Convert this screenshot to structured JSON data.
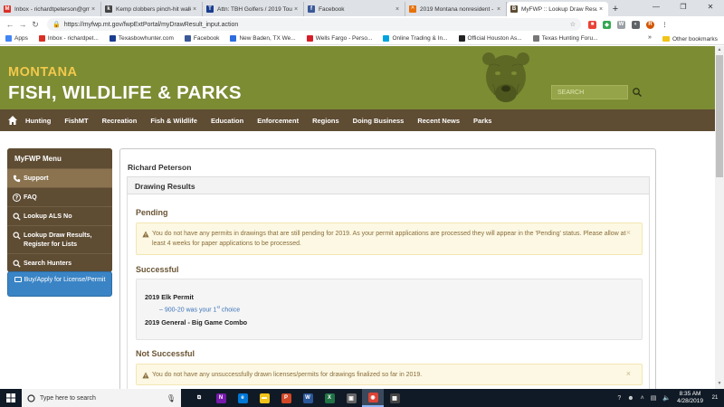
{
  "browser": {
    "tabs": [
      {
        "title": "Inbox - richardtpeterson@gm",
        "favicon": "gmail-icon",
        "color": "#d93025",
        "glyph": "M"
      },
      {
        "title": "Kemp clobbers pinch-hit walk",
        "favicon": "news-icon",
        "color": "#444444",
        "glyph": "k"
      },
      {
        "title": "Attn: TBH Golfers / 2019 Tou",
        "favicon": "forum-icon",
        "color": "#1a3d8f",
        "glyph": "T"
      },
      {
        "title": "Facebook",
        "favicon": "facebook-icon",
        "color": "#3b5998",
        "glyph": "f"
      },
      {
        "title": "2019 Montana nonresident -",
        "favicon": "hunt-icon",
        "color": "#e8710a",
        "glyph": "^"
      },
      {
        "title": "MyFWP :: Lookup Draw Resu",
        "favicon": "fwp-icon",
        "color": "#5e4c33",
        "glyph": "B",
        "active": true
      }
    ],
    "url": "https://myfwp.mt.gov/fwpExtPortal/myDrawResult_input.action",
    "bookmarks": [
      {
        "label": "Apps",
        "color": "#4285f4"
      },
      {
        "label": "Inbox - richardpet...",
        "color": "#d93025"
      },
      {
        "label": "Texasbowhunter.com",
        "color": "#1a3d8f"
      },
      {
        "label": "Facebook",
        "color": "#3b5998"
      },
      {
        "label": "New Baden, TX We...",
        "color": "#2d6cdf"
      },
      {
        "label": "Wells Fargo - Perso...",
        "color": "#d71e28"
      },
      {
        "label": "Online Trading & In...",
        "color": "#00a3e0"
      },
      {
        "label": "Official Houston As...",
        "color": "#222222"
      },
      {
        "label": "Texas Hunting Foru...",
        "color": "#777777"
      }
    ],
    "bookmarks_more": "»",
    "other_bookmarks": "Other bookmarks"
  },
  "site": {
    "brand_line1": "MONTANA",
    "brand_line2": "FISH, WILDLIFE & PARKS",
    "search_placeholder": "SEARCH",
    "nav": [
      "Hunting",
      "FishMT",
      "Recreation",
      "Fish & Wildlife",
      "Education",
      "Enforcement",
      "Regions",
      "Doing Business",
      "Recent News",
      "Parks"
    ],
    "colors": {
      "header": "#7c8c33",
      "nav": "#5e4c33",
      "brand_accent": "#f2c94c",
      "section_title": "#6a5534"
    }
  },
  "sidebar": {
    "title": "MyFWP Menu",
    "items": [
      {
        "label": "Support",
        "icon": "phone-icon"
      },
      {
        "label": "FAQ",
        "icon": "question-icon"
      },
      {
        "label": "Lookup ALS No",
        "icon": "search-icon"
      },
      {
        "label": "Lookup Draw Results, Register for Lists",
        "icon": "search-icon"
      },
      {
        "label": "Search Hunters",
        "icon": "search-icon"
      }
    ],
    "buy_button": "Buy/Apply for License/Permit"
  },
  "main": {
    "user_name": "Richard Peterson",
    "panel_title": "Drawing Results",
    "pending": {
      "title": "Pending",
      "message": "You do not have any permits in drawings that are still pending for 2019.  As your permit applications are processed they will appear in the 'Pending' status.  Please allow at least 4 weeks for paper applications to be processed."
    },
    "successful": {
      "title": "Successful",
      "permit1": "2019 Elk Permit",
      "choice_prefix": "– 900-20 was your 1",
      "choice_sup": "st",
      "choice_suffix": " choice",
      "permit2": "2019 General - Big Game Combo"
    },
    "not_successful": {
      "title": "Not Successful",
      "message": "You do not have any unsuccessfully drawn licenses/permits for drawings finalized so far in 2019."
    },
    "close_glyph": "×"
  },
  "taskbar": {
    "search_placeholder": "Type here to search",
    "apps": [
      {
        "name": "task-view-icon",
        "color": "#101a26",
        "glyph": "⧉"
      },
      {
        "name": "onenote-icon",
        "color": "#7719aa",
        "glyph": "N"
      },
      {
        "name": "edge-icon",
        "color": "#0078d7",
        "glyph": "e"
      },
      {
        "name": "file-explorer-icon",
        "color": "#f0c419",
        "glyph": "▬"
      },
      {
        "name": "powerpoint-icon",
        "color": "#d24726",
        "glyph": "P"
      },
      {
        "name": "word-icon",
        "color": "#2b579a",
        "glyph": "W"
      },
      {
        "name": "excel-icon",
        "color": "#217346",
        "glyph": "X"
      },
      {
        "name": "store-icon",
        "color": "#666666",
        "glyph": "▣"
      },
      {
        "name": "chrome-icon",
        "color": "#db4437",
        "glyph": "◉",
        "active": true
      },
      {
        "name": "calculator-icon",
        "color": "#444444",
        "glyph": "▦"
      }
    ],
    "time": "8:35 AM",
    "date": "4/28/2019",
    "notifications": "21"
  }
}
